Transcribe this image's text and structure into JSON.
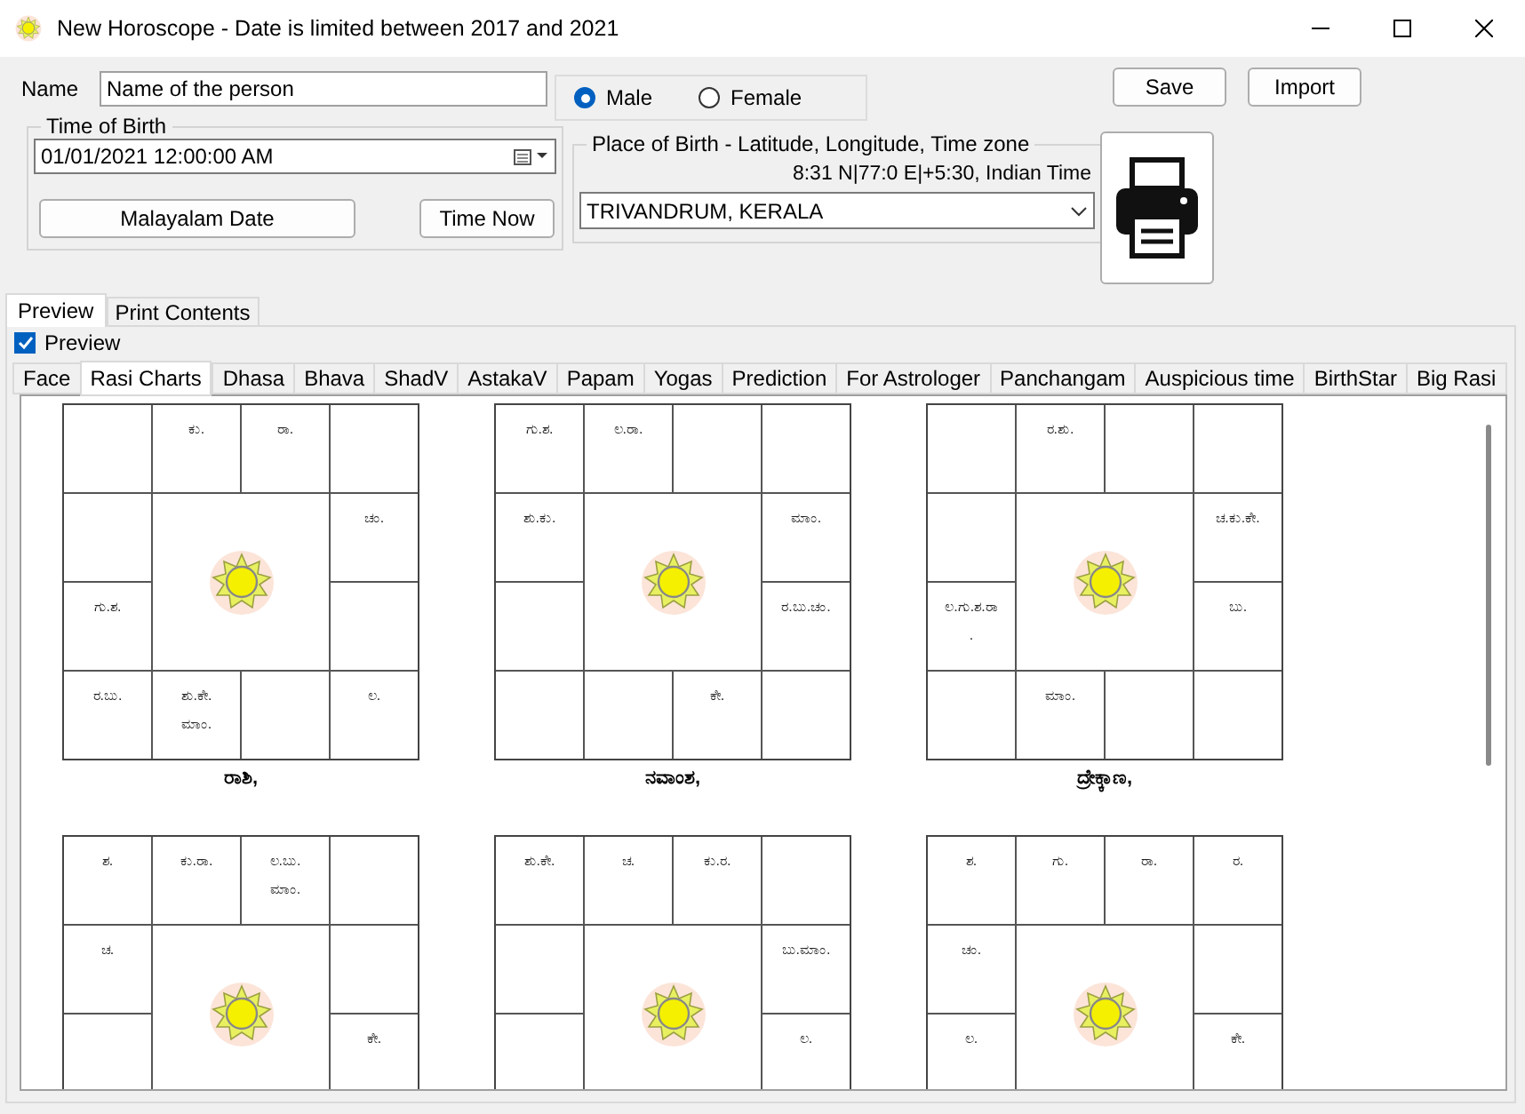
{
  "window": {
    "title": "New Horoscope - Date is limited between 2017 and 2021"
  },
  "form": {
    "name_label": "Name",
    "name_value": "Name of the person",
    "gender": [
      {
        "label": "Male",
        "selected": true
      },
      {
        "label": "Female",
        "selected": false
      }
    ],
    "time_of_birth": {
      "label": "Time of Birth",
      "value": "01/01/2021  12:00:00 AM",
      "buttons": [
        "Malayalam Date",
        "Time Now"
      ]
    },
    "place_of_birth": {
      "label": "Place of Birth - Latitude, Longitude, Time zone",
      "coordinates": "8:31 N|77:0 E|+5:30, Indian Time",
      "value": "TRIVANDRUM, KERALA"
    },
    "buttons": [
      "Save",
      "Import"
    ]
  },
  "outer_tabs": [
    {
      "label": "Preview",
      "selected": true
    },
    {
      "label": "Print Contents",
      "selected": false
    }
  ],
  "preview_checkbox": {
    "label": "Preview",
    "checked": true
  },
  "tabs": [
    {
      "label": "Face",
      "selected": false
    },
    {
      "label": "Rasi Charts",
      "selected": true
    },
    {
      "label": "Dhasa",
      "selected": false
    },
    {
      "label": "Bhava",
      "selected": false
    },
    {
      "label": "ShadV",
      "selected": false
    },
    {
      "label": "AstakaV",
      "selected": false
    },
    {
      "label": "Papam",
      "selected": false
    },
    {
      "label": "Yogas",
      "selected": false
    },
    {
      "label": "Prediction",
      "selected": false
    },
    {
      "label": "For Astrologer",
      "selected": false
    },
    {
      "label": "Panchangam",
      "selected": false
    },
    {
      "label": "Auspicious time",
      "selected": false
    },
    {
      "label": "BirthStar",
      "selected": false
    },
    {
      "label": "Big Rasi",
      "selected": false
    }
  ],
  "charts": [
    {
      "title": "ರಾಶಿ,",
      "houses": {
        "top_2": [
          "ಕು."
        ],
        "top_3": [
          "ರಾ."
        ],
        "right_1": [
          "ಚಂ."
        ],
        "left_2": [
          "ಗು.ಶ."
        ],
        "bottom_1": [
          "ರ.ಬು."
        ],
        "bottom_2": [
          "ಶು.ಕೇ.",
          "ಮಾಂ."
        ],
        "bottom_4": [
          "ಲ."
        ]
      }
    },
    {
      "title": "ನವಾಂಶ,",
      "houses": {
        "top_1": [
          "ಗು.ಶ."
        ],
        "top_2": [
          "ಲ.ರಾ."
        ],
        "left_1": [
          "ಶು.ಕು."
        ],
        "right_1": [
          "ಮಾಂ."
        ],
        "right_2": [
          "ರ.ಬು.ಚಂ."
        ],
        "bottom_3": [
          "ಕೇ."
        ]
      }
    },
    {
      "title": "ದ್ರೇಕ್ಕಾಣ,",
      "houses": {
        "top_2": [
          "ರ.ಶು."
        ],
        "right_1": [
          "ಚ.ಕು.ಕೇ."
        ],
        "left_2": [
          "ಲ.ಗು.ಶ.ರಾ",
          "."
        ],
        "right_2": [
          "ಬು."
        ],
        "bottom_2": [
          "ಮಾಂ."
        ]
      }
    },
    {
      "houses": {
        "top_1": [
          "ಶ."
        ],
        "top_2": [
          "ಕು.ರಾ."
        ],
        "top_3": [
          "ಲ.ಬು.",
          "ಮಾಂ."
        ],
        "left_1": [
          "ಚ."
        ],
        "right_2": [
          "ಕೇ."
        ]
      }
    },
    {
      "houses": {
        "top_1": [
          "ಶು.ಕೇ."
        ],
        "top_2": [
          "ಚ."
        ],
        "top_3": [
          "ಕು.ರ."
        ],
        "right_1": [
          "ಬು.ಮಾಂ."
        ],
        "right_2": [
          "ಲ."
        ]
      }
    },
    {
      "houses": {
        "top_1": [
          "ಶ."
        ],
        "top_2": [
          "ಗು."
        ],
        "top_3": [
          "ರಾ."
        ],
        "top_4": [
          "ರ."
        ],
        "left_1": [
          "ಚಂ."
        ],
        "left_2": [
          "ಲ."
        ],
        "right_2": [
          "ಕೇ."
        ]
      }
    }
  ]
}
